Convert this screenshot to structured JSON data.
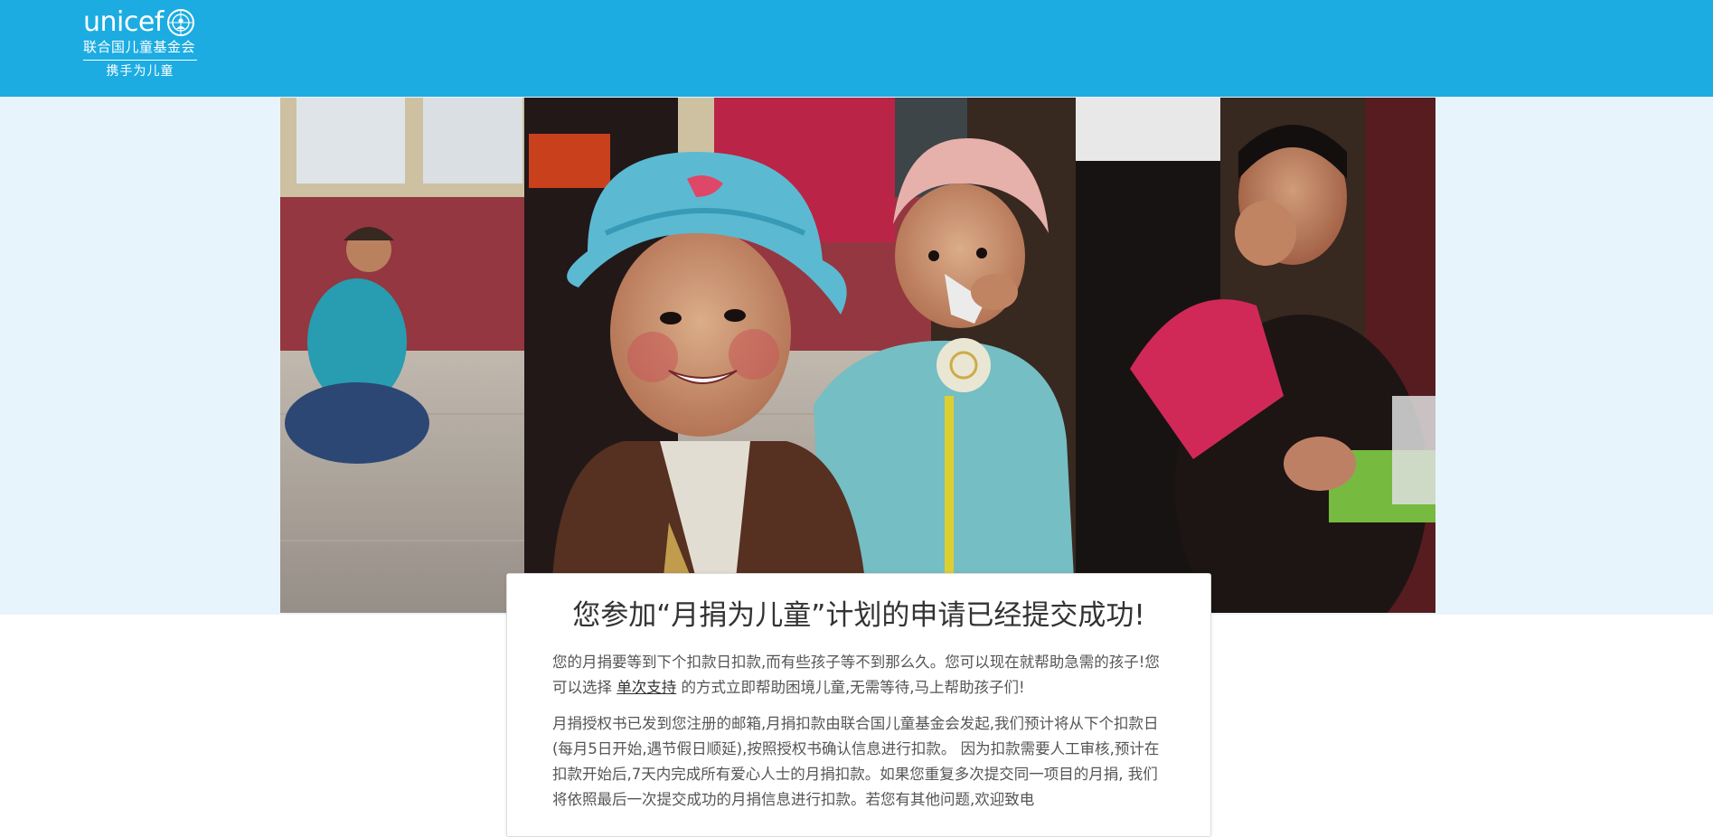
{
  "header": {
    "logo_word": "unicef",
    "logo_org": "联合国儿童基金会",
    "logo_slogan": "携手为儿童",
    "background_color": "#1cace2"
  },
  "hero": {
    "image_icon": "children-photo"
  },
  "confirmation": {
    "title": "您参加“月捐为儿童”计划的申请已经提交成功!",
    "para1_before": "您的月捐要等到下个扣款日扣款,而有些孩子等不到那么久。您可以现在就帮助急需的孩子!您可以选择 ",
    "para1_link": "单次支持",
    "para1_after": " 的方式立即帮助困境儿童,无需等待,马上帮助孩子们!",
    "para2": "月捐授权书已发到您注册的邮箱,月捐扣款由联合国儿童基金会发起,我们预计将从下个扣款日(每月5日开始,遇节假日顺延),按照授权书确认信息进行扣款。 因为扣款需要人工审核,预计在扣款开始后,7天内完成所有爱心人士的月捐扣款。如果您重复多次提交同一项目的月捐, 我们将依照最后一次提交成功的月捐信息进行扣款。若您有其他问题,欢迎致电"
  }
}
